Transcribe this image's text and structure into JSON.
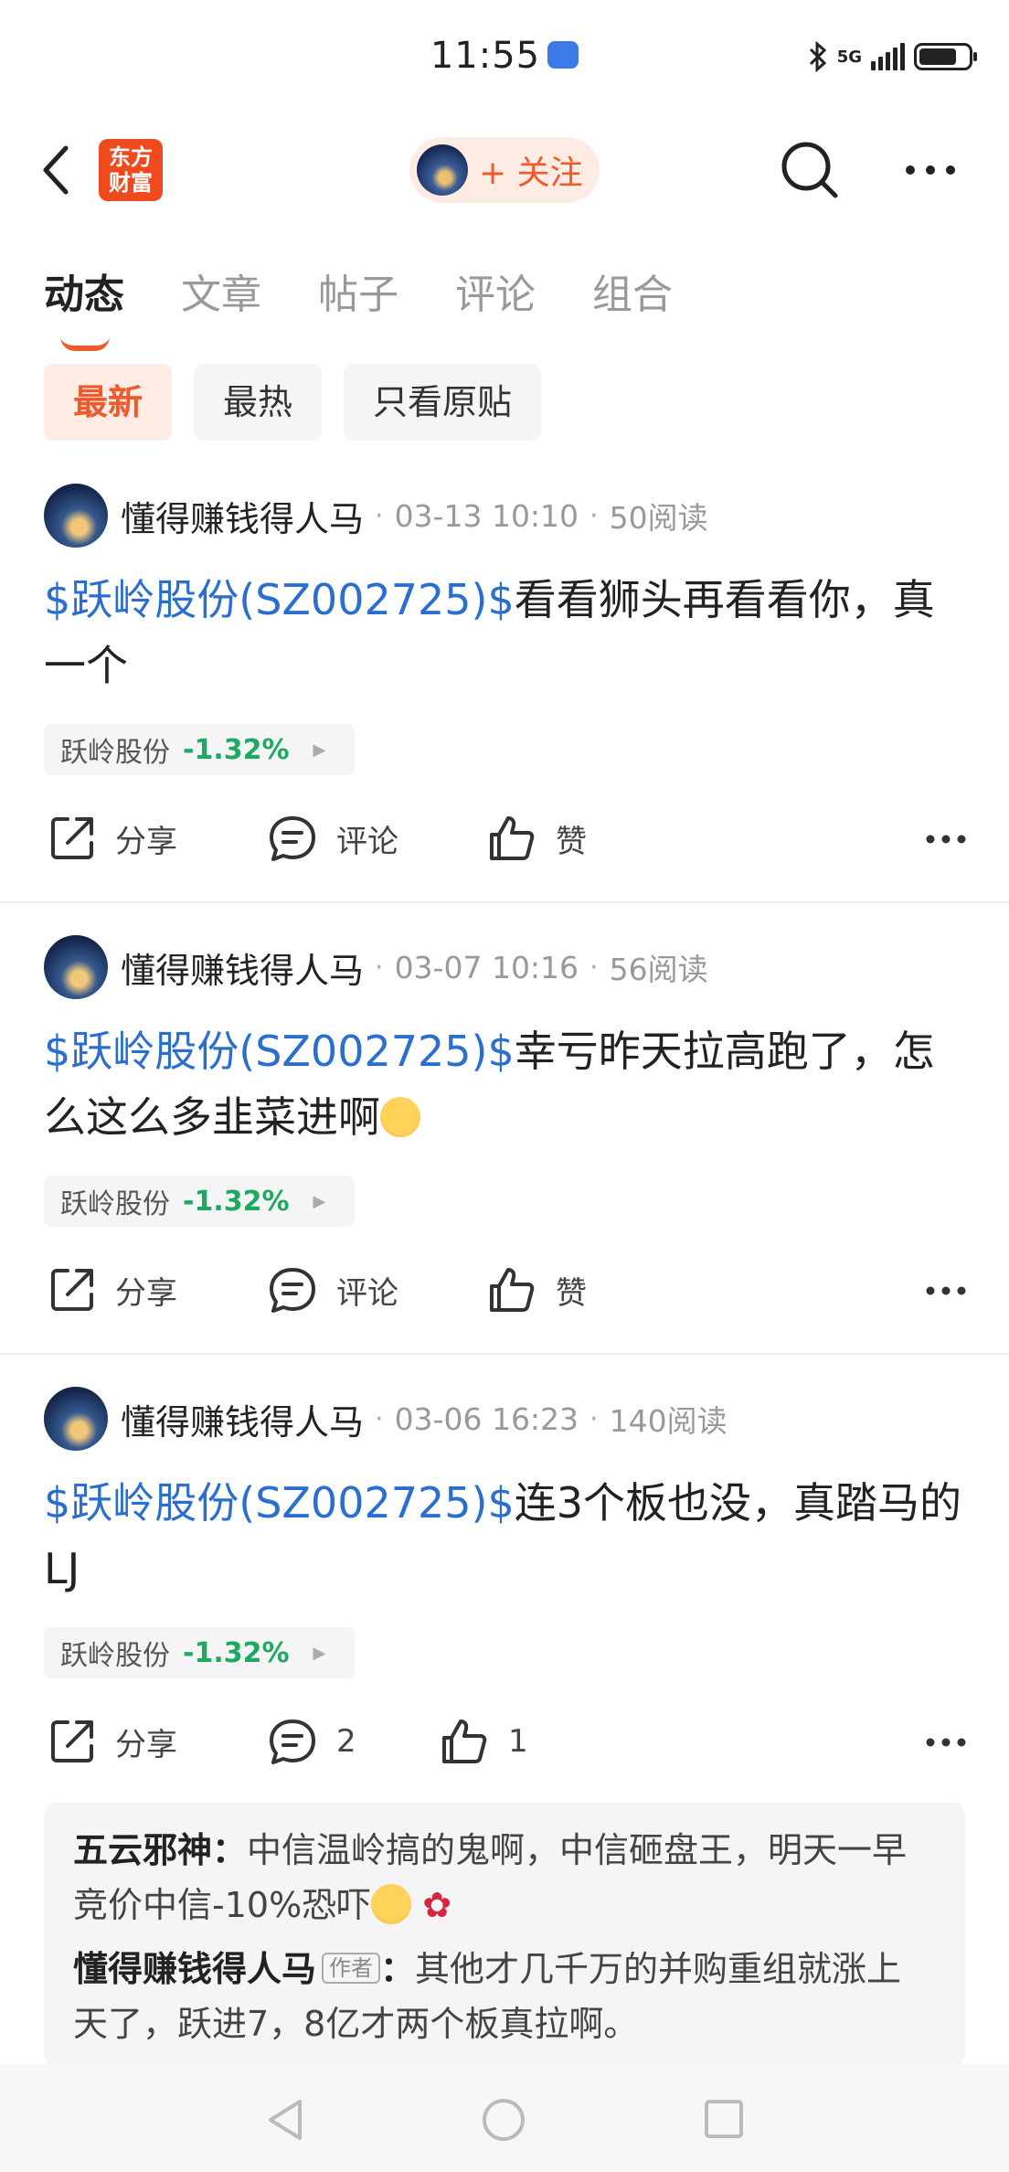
{
  "status": {
    "time": "11:55",
    "network": "5G"
  },
  "header": {
    "logo_line1": "东方",
    "logo_line2": "财富",
    "follow_label": "+ 关注"
  },
  "tabs": [
    {
      "label": "动态"
    },
    {
      "label": "文章"
    },
    {
      "label": "帖子"
    },
    {
      "label": "评论"
    },
    {
      "label": "组合"
    }
  ],
  "filters": [
    {
      "label": "最新"
    },
    {
      "label": "最热"
    },
    {
      "label": "只看原贴"
    }
  ],
  "posts": [
    {
      "user": "懂得赚钱得人马",
      "date": "03-13 10:10",
      "reads": "50阅读",
      "stock": "$跃岭股份(SZ002725)$",
      "text": "看看狮头再看看你，真一个",
      "pill_name": "跃岭股份",
      "pill_change": "-1.32%",
      "share": "分享",
      "comment": "评论",
      "like": "赞"
    },
    {
      "user": "懂得赚钱得人马",
      "date": "03-07 10:16",
      "reads": "56阅读",
      "stock": "$跃岭股份(SZ002725)$",
      "text": "幸亏昨天拉高跑了，怎么这么多韭菜进啊",
      "pill_name": "跃岭股份",
      "pill_change": "-1.32%",
      "share": "分享",
      "comment": "评论",
      "like": "赞"
    },
    {
      "user": "懂得赚钱得人马",
      "date": "03-06 16:23",
      "reads": "140阅读",
      "stock": "$跃岭股份(SZ002725)$",
      "text": "连3个板也没，真踏马的LJ",
      "pill_name": "跃岭股份",
      "pill_change": "-1.32%",
      "share": "分享",
      "comment": "2",
      "like": "1"
    }
  ],
  "comments": [
    {
      "user": "五云邪神",
      "sep": "：",
      "text": "中信温岭搞的鬼啊，中信砸盘王，明天一早竞价中信-10%恐吓"
    },
    {
      "user": "懂得赚钱得人马",
      "tag": "作者",
      "sep": "：",
      "text": "其他才几千万的并购重组就涨上天了，跃进7，8亿才两个板真拉啊。"
    }
  ],
  "colors": {
    "accent": "#f0592b",
    "stock_link": "#2a6fcf",
    "down_green": "#1fa862"
  }
}
